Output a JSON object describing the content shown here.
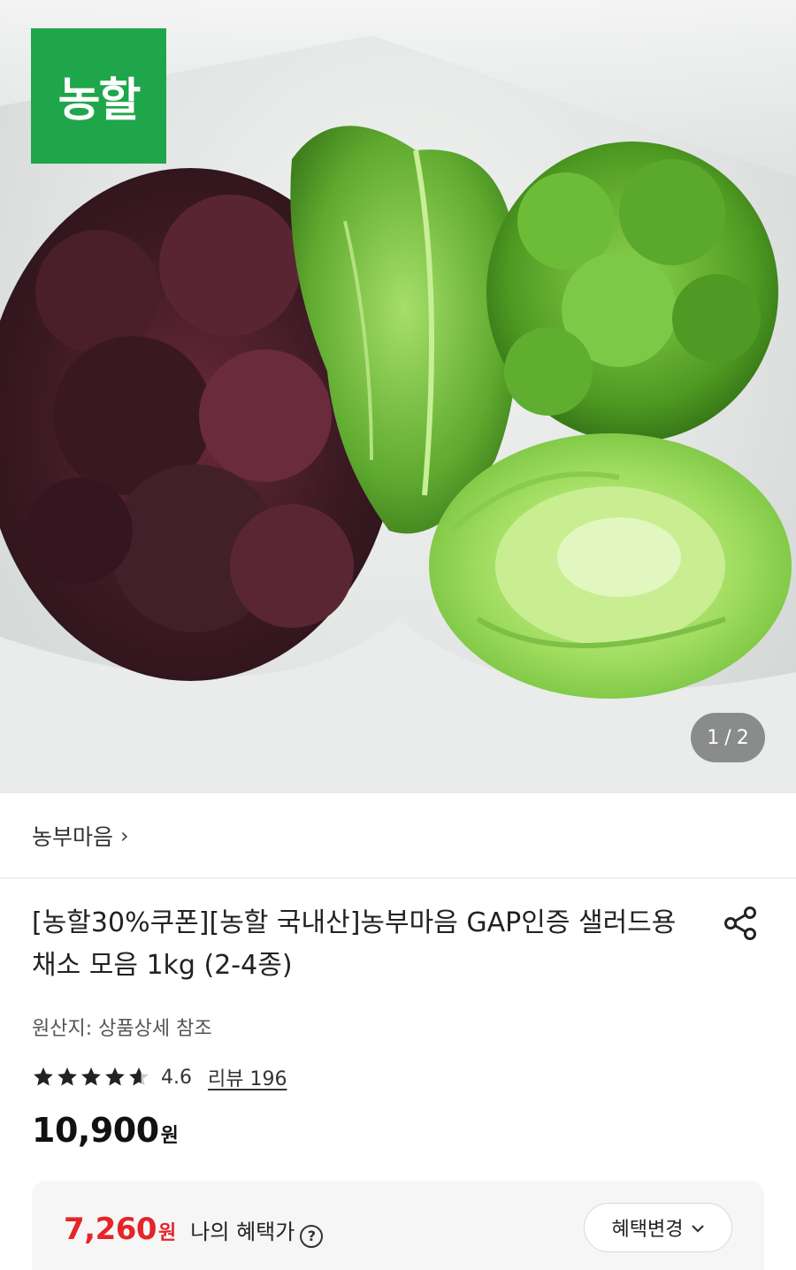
{
  "hero": {
    "brand_logo": "농할",
    "page_current": "1",
    "page_separator": "/",
    "page_total": "2"
  },
  "seller": {
    "name": "농부마음",
    "chevron": "›"
  },
  "product": {
    "title": "[농할30%쿠폰][농할 국내산]농부마음 GAP인증 샐러드용 채소 모음 1kg (2-4종)",
    "origin": "원산지: 상품상세 참조",
    "rating": "4.6",
    "rating_stars": 4.6,
    "review_link": "리뷰 196",
    "price": "10,900",
    "price_unit": "원"
  },
  "benefit": {
    "price": "7,260",
    "price_unit": "원",
    "label": "나의 혜택가",
    "help_icon": "?",
    "change_button": "혜택변경",
    "chevron": "⌄"
  },
  "colors": {
    "brand_green": "#1fa64a",
    "benefit_red": "#e52528",
    "text_dark": "#222222"
  },
  "icons": [
    "share-icon",
    "star-icon",
    "help-icon",
    "chevron-down-icon",
    "chevron-right-icon"
  ]
}
